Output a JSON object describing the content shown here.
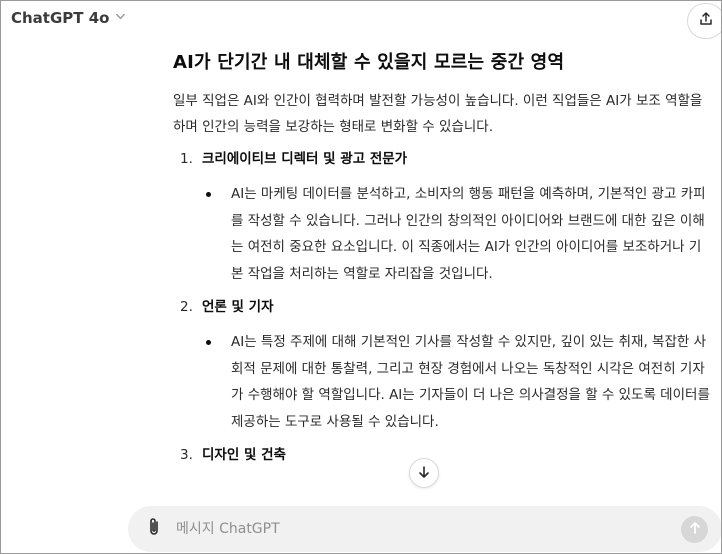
{
  "header": {
    "model_name": "ChatGPT 4o",
    "chevron_icon": "chevron-down-icon",
    "share_icon": "share-icon"
  },
  "response": {
    "heading": "AI가 단기간 내 대체할 수 있을지 모르는 중간 영역",
    "intro": "일부 직업은 AI와 인간이 협력하며 발전할 가능성이 높습니다. 이런 직업들은 AI가 보조 역할을 하며 인간의 능력을 보강하는 형태로 변화할 수 있습니다.",
    "items": [
      {
        "number": "1.",
        "title": "크리에이티브 디렉터 및 광고 전문가",
        "bullet": "AI는 마케팅 데이터를 분석하고, 소비자의 행동 패턴을 예측하며, 기본적인 광고 카피를 작성할 수 있습니다. 그러나 인간의 창의적인 아이디어와 브랜드에 대한 깊은 이해는 여전히 중요한 요소입니다. 이 직종에서는 AI가 인간의 아이디어를 보조하거나 기본 작업을 처리하는 역할로 자리잡을 것입니다."
      },
      {
        "number": "2.",
        "title": "언론 및 기자",
        "bullet": "AI는 특정 주제에 대해 기본적인 기사를 작성할 수 있지만, 깊이 있는 취재, 복잡한 사회적 문제에 대한 통찰력, 그리고 현장 경험에서 나오는 독창적인 시각은 여전히 기자가 수행해야 할 역할입니다. AI는 기자들이 더 나은 의사결정을 할 수 있도록 데이터를 제공하는 도구로 사용될 수 있습니다."
      },
      {
        "number": "3.",
        "title": "디자인 및 건축"
      }
    ]
  },
  "composer": {
    "placeholder": "메시지 ChatGPT",
    "attach_icon": "paperclip-icon",
    "send_icon": "arrow-up-icon"
  },
  "scroll_button_icon": "arrow-down-icon"
}
